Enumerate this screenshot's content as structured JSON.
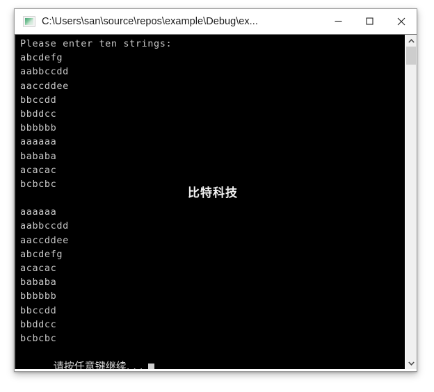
{
  "window": {
    "title": "C:\\Users\\san\\source\\repos\\example\\Debug\\ex...",
    "icon": "console-app-icon",
    "minimize_label": "—",
    "maximize_label": "□",
    "close_label": "✕"
  },
  "console": {
    "background_color": "#000000",
    "text_color": "#c8c8c8",
    "watermark": "比特科技",
    "lines": [
      "Please enter ten strings:",
      "abcdefg",
      "aabbccdd",
      "aaccddee",
      "bbccdd",
      "bbddcc",
      "bbbbbb",
      "aaaaaa",
      "bababa",
      "acacac",
      "bcbcbc",
      "",
      "aaaaaa",
      "aabbccdd",
      "aaccddee",
      "abcdefg",
      "acacac",
      "bababa",
      "bbbbbb",
      "bbccdd",
      "bbddcc",
      "bcbcbc"
    ],
    "prompt_line": "请按任意键继续. . .",
    "cursor": "block-cursor"
  },
  "scrollbar": {
    "up_arrow": "chevron-up-icon",
    "down_arrow": "chevron-down-icon",
    "thumb_position_percent": 0,
    "thumb_size_percent": 6
  }
}
